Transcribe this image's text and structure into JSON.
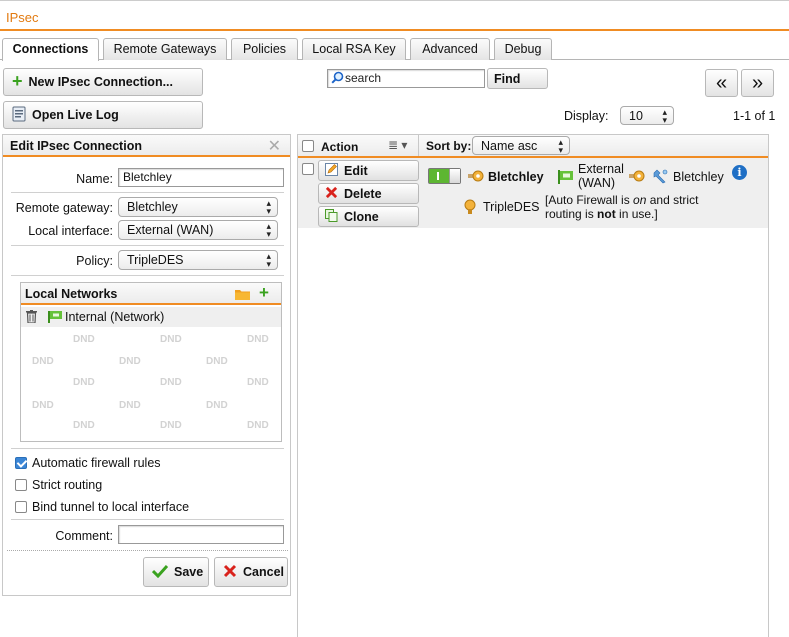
{
  "app": {
    "title": "IPsec"
  },
  "tabs": [
    {
      "label": "Connections",
      "active": true
    },
    {
      "label": "Remote Gateways"
    },
    {
      "label": "Policies"
    },
    {
      "label": "Local RSA Key"
    },
    {
      "label": "Advanced"
    },
    {
      "label": "Debug"
    }
  ],
  "toolbar": {
    "new_connection": "New IPsec Connection...",
    "open_live_log": "Open Live Log",
    "search_placeholder": "search",
    "find": "Find",
    "prev": "«",
    "next": "»",
    "display_label": "Display:",
    "display_value": "10",
    "page_info": "1-1 of 1"
  },
  "edit_panel": {
    "title": "Edit IPsec Connection",
    "name_label": "Name:",
    "name_value": "Bletchley",
    "remote_gateway_label": "Remote gateway:",
    "remote_gateway_value": "Bletchley",
    "local_interface_label": "Local interface:",
    "local_interface_value": "External (WAN)",
    "policy_label": "Policy:",
    "policy_value": "TripleDES",
    "local_networks": {
      "title": "Local Networks",
      "items": [
        "Internal (Network)"
      ],
      "dnd": "DND"
    },
    "auto_firewall": {
      "label": "Automatic firewall rules",
      "checked": true
    },
    "strict_routing": {
      "label": "Strict routing",
      "checked": false
    },
    "bind_tunnel": {
      "label": "Bind tunnel to local interface",
      "checked": false
    },
    "comment_label": "Comment:",
    "comment_value": "",
    "save": "Save",
    "cancel": "Cancel"
  },
  "list": {
    "action_header": "Action",
    "sort_label": "Sort by:",
    "sort_value": "Name asc",
    "rows": [
      {
        "edit": "Edit",
        "delete": "Delete",
        "clone": "Clone",
        "toggle_on": true,
        "name": "Bletchley",
        "interface_line1": "External",
        "interface_line2": "(WAN)",
        "gateway": "Bletchley",
        "policy": "TripleDES",
        "note_p1": "[Auto Firewall is ",
        "note_on": "on",
        "note_p2": " and strict",
        "note_p3": "routing is ",
        "note_not": "not",
        "note_p4": " in use.]"
      }
    ]
  },
  "colors": {
    "accent": "#f08c23",
    "title": "#e27a10",
    "info": "#1f6fc5",
    "green": "#4caf25",
    "red": "#d9221c"
  }
}
